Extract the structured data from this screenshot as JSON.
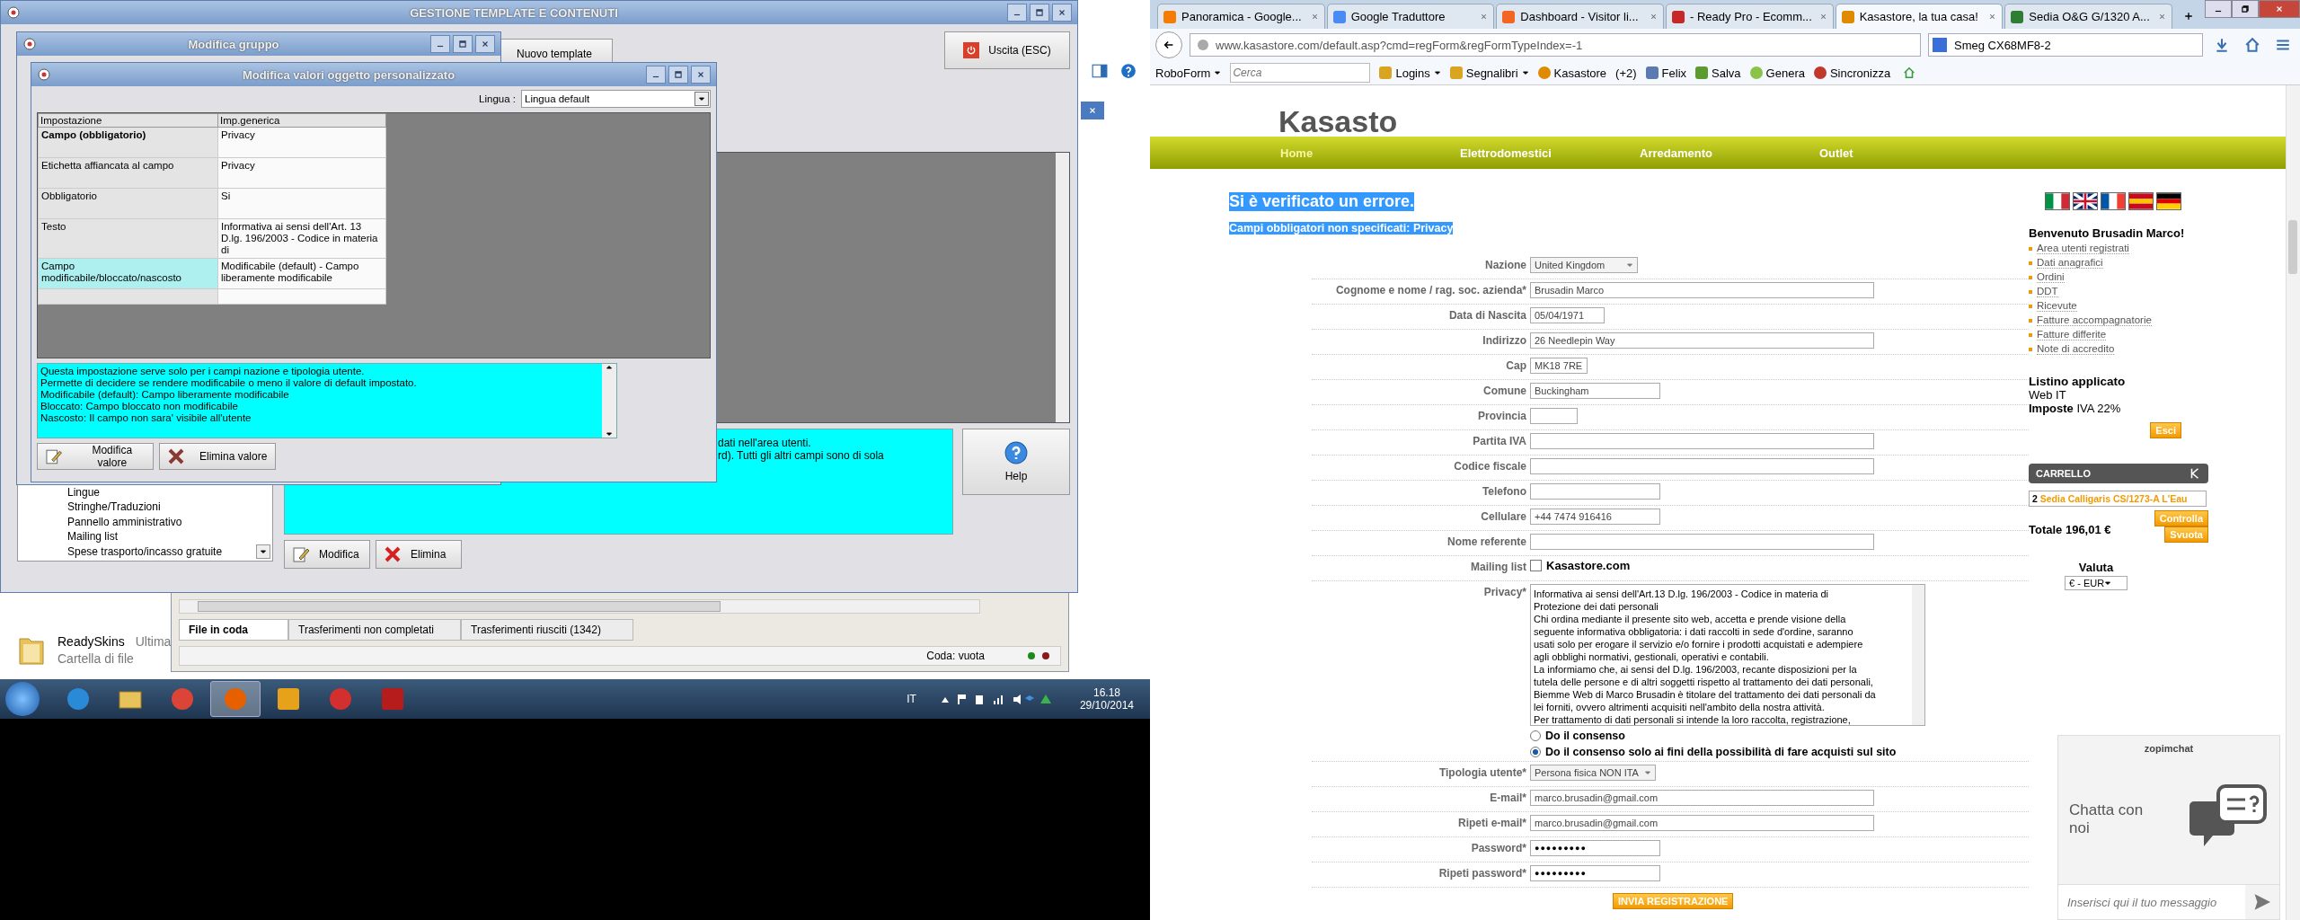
{
  "desktop": {
    "main_window": {
      "title": "GESTIONE TEMPLATE E CONTENUTI",
      "new_template_button": "Nuovo template",
      "exit_button": "Uscita (ESC)",
      "tree_items": [
        "Lingue",
        "Stringhe/Traduzioni",
        "Pannello amministrativo",
        "Mailing list",
        "Spese trasporto/incasso gratuite"
      ],
      "description_lines": [
        "dati nell'area utenti.",
        "rd). Tutti gli altri campi sono di sola"
      ],
      "help_button": "Help",
      "buttons": [
        {
          "label": "Modifica",
          "kind": "edit"
        },
        {
          "label": "Elimina",
          "kind": "delete"
        }
      ]
    },
    "group_dialog": {
      "title": "Modifica gruppo"
    },
    "values_dialog": {
      "title": "Modifica valori oggetto personalizzato",
      "language_label": "Lingua :",
      "language_value": "Lingua default",
      "columns": [
        "Impostazione",
        "Imp.generica"
      ],
      "rows": [
        {
          "setting": "Campo (obbligatorio)",
          "value": "Privacy",
          "bold": true,
          "selected": false
        },
        {
          "setting": "Etichetta affiancata al campo",
          "value": "Privacy",
          "bold": false,
          "selected": false
        },
        {
          "setting": "Obbligatorio",
          "value": "Si",
          "bold": false,
          "selected": false
        },
        {
          "setting": "Testo",
          "value": "Informativa ai sensi dell'Art. 13 D.lg. 196/2003 - Codice in materia di",
          "bold": false,
          "selected": false
        },
        {
          "setting": "Campo modificabile/bloccato/nascosto",
          "value": "Modificabile (default) - Campo liberamente modificabile",
          "bold": false,
          "selected": true
        }
      ],
      "help_lines": [
        "Questa impostazione serve solo per i campi nazione e tipologia utente.",
        "Permette di decidere se rendere modificabile o meno il valore di default impostato.",
        "Modificabile (default): Campo liberamente modificabile",
        "Bloccato: Campo bloccato non modificabile",
        "Nascosto: Il campo non sara' visibile all'utente"
      ],
      "buttons": [
        {
          "label": "Modifica valore",
          "kind": "edit"
        },
        {
          "label": "Elimina valore",
          "kind": "delete"
        }
      ]
    },
    "ftp_window": {
      "tabs": [
        {
          "label": "File in coda",
          "selected": true
        },
        {
          "label": "Trasferimenti non completati",
          "selected": false
        },
        {
          "label": "Trasferimenti riusciti (1342)",
          "selected": false
        }
      ],
      "queue_status": "Coda: vuota"
    },
    "folder_item": {
      "name": "ReadySkins",
      "detail": "Ultima",
      "type": "Cartella di file"
    },
    "taskbar": {
      "apps": [
        {
          "kind": "ie",
          "active": false
        },
        {
          "kind": "folder",
          "active": false
        },
        {
          "kind": "chrome",
          "active": false
        },
        {
          "kind": "firefox",
          "active": true
        },
        {
          "kind": "outlook",
          "active": false
        },
        {
          "kind": "strawberry",
          "active": false
        },
        {
          "kind": "filezilla",
          "active": false
        }
      ],
      "language": "IT",
      "time": "16.18",
      "date": "29/10/2014"
    }
  },
  "browser": {
    "tabs": [
      {
        "title": "Panoramica - Google...",
        "color": "#f57c00",
        "selected": false
      },
      {
        "title": "Google Traduttore",
        "color": "#4a8af4",
        "selected": false
      },
      {
        "title": "Dashboard - Visitor li...",
        "color": "#f26522",
        "selected": false
      },
      {
        "title": "- Ready Pro - Ecomm...",
        "color": "#c62828",
        "selected": false
      },
      {
        "title": "Kasastore, la tua casa!",
        "color": "#e08a00",
        "selected": true
      },
      {
        "title": "Sedia O&G G/1320 A...",
        "color": "#2e7d32",
        "selected": false
      }
    ],
    "address": "www.kasastore.com/default.asp?cmd=regForm&regFormTypeIndex=-1",
    "search_value": "Smeg CX68MF8-2",
    "bookmarks": {
      "roboform": "RoboForm",
      "search_placeholder": "Cerca",
      "items": [
        {
          "label": "Logins",
          "kind": "menu"
        },
        {
          "label": "Segnalibri",
          "kind": "menu"
        },
        {
          "label": "Kasastore",
          "kind": "site"
        },
        {
          "label": "(+2)",
          "kind": "count"
        },
        {
          "label": "Felix",
          "kind": "card"
        },
        {
          "label": "Salva",
          "kind": "save"
        },
        {
          "label": "Genera",
          "kind": "generate"
        },
        {
          "label": "Sincronizza",
          "kind": "sync"
        }
      ]
    },
    "page": {
      "logo_text": "Kasasto",
      "nav": [
        {
          "label": "Home",
          "selected": true
        },
        {
          "label": "Elettrodomestici",
          "selected": false
        },
        {
          "label": "Arredamento",
          "selected": false
        },
        {
          "label": "Outlet",
          "selected": false
        }
      ],
      "error_title": "Si è verificato un errore.",
      "error_detail": "Campi obbligatori non specificati: Privacy",
      "form": [
        {
          "label": "Nazione",
          "kind": "select",
          "value": "United Kingdom"
        },
        {
          "label": "Cognome e nome / rag. soc. azienda*",
          "kind": "text",
          "value": "Brusadin Marco"
        },
        {
          "label": "Data di Nascita",
          "kind": "text",
          "value": "05/04/1971"
        },
        {
          "label": "Indirizzo",
          "kind": "text",
          "value": "26 Needlepin Way"
        },
        {
          "label": "Cap",
          "kind": "text",
          "value": "MK18 7RE"
        },
        {
          "label": "Comune",
          "kind": "text",
          "value": "Buckingham"
        },
        {
          "label": "Provincia",
          "kind": "text"
        },
        {
          "label": "Partita IVA",
          "kind": "text"
        },
        {
          "label": "Codice fiscale",
          "kind": "text"
        },
        {
          "label": "Telefono",
          "kind": "text"
        },
        {
          "label": "Cellulare",
          "kind": "text",
          "value": "+44 7474 916416"
        },
        {
          "label": "Nome referente",
          "kind": "text"
        },
        {
          "label": "Mailing list",
          "kind": "checkbox",
          "value": "Kasastore.com",
          "checked": false
        },
        {
          "label": "Privacy*",
          "kind": "textarea",
          "lines": [
            "Informativa ai sensi dell'Art.13 D.lg. 196/2003 - Codice in materia di",
            "Protezione dei dati personali",
            "Chi ordina mediante il presente sito web, accetta e prende visione della",
            "seguente informativa obbligatoria: i dati raccolti in sede d'ordine, saranno",
            "usati solo per erogare il servizio e/o fornire i prodotti acquistati e adempiere",
            "agli obblighi normativi, gestionali, operativi e contabili.",
            "La informiamo che, ai sensi del D.lg. 196/2003, recante disposizioni per la",
            "tutela delle persone e di altri soggetti rispetto al trattamento dei dati personali,",
            "Biemme Web di Marco Brusadin è titolare del trattamento dei dati personali da",
            "lei forniti, ovvero altrimenti acquisiti nell'ambito della nostra attività.",
            "Per trattamento di dati personali si intende la loro raccolta, registrazione,"
          ],
          "options": [
            {
              "label": "Do il consenso",
              "selected": false
            },
            {
              "label": "Do il consenso solo ai fini della possibilità di fare acquisti sul sito",
              "selected": true
            }
          ]
        },
        {
          "label": "Tipologia utente*",
          "kind": "select",
          "value": "Persona fisica NON ITA"
        },
        {
          "label": "E-mail*",
          "kind": "text",
          "value": "marco.brusadin@gmail.com"
        },
        {
          "label": "Ripeti e-mail*",
          "kind": "text",
          "value": "marco.brusadin@gmail.com"
        },
        {
          "label": "Password*",
          "kind": "password",
          "value": "●●●●●●●●●"
        },
        {
          "label": "Ripeti password*",
          "kind": "password",
          "value": "●●●●●●●●●"
        }
      ],
      "submit_button": "INVIA REGISTRAZIONE",
      "sidebar": {
        "flags": [
          {
            "kind": "it"
          },
          {
            "kind": "gb"
          },
          {
            "kind": "fr"
          },
          {
            "kind": "es"
          },
          {
            "kind": "de"
          }
        ],
        "welcome": "Benvenuto Brusadin Marco!",
        "links": [
          "Area utenti registrati",
          "Dati anagrafici",
          "Ordini",
          "DDT",
          "Ricevute",
          "Fatture accompagnatorie",
          "Fatture differite",
          "Note di accredito"
        ],
        "price_list_label": "Listino applicato",
        "price_list": "Web IT",
        "taxes": "**Imposte** IVA 22%",
        "logout_button": "Esci",
        "cart_title": "CARRELLO",
        "cart_items": [
          {
            "qty": "2",
            "name": "Sedia Calligaris CS/1273-A L'Eau"
          }
        ],
        "check_button": "Controlla",
        "empty_button": "Svuota",
        "total": "Totale 196,01 €",
        "currency_label": "Valuta",
        "currency": "€ - EUR"
      },
      "chat": {
        "brand": "zopimchat",
        "title": "Chatta con noi",
        "placeholder": "Inserisci qui il tuo messaggio"
      }
    }
  }
}
